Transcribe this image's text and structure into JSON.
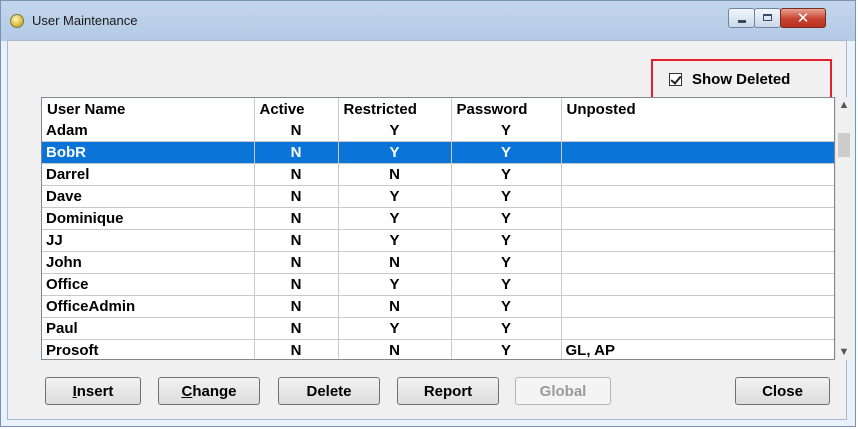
{
  "window": {
    "title": "User Maintenance",
    "icon": "app-icon",
    "controls": {
      "minimize_icon": "minimize-icon",
      "maximize_icon": "maximize-icon",
      "close_glyph": "✕"
    }
  },
  "show_deleted": {
    "label": "Show Deleted",
    "checked": true,
    "highlight_color": "#e0202c"
  },
  "table": {
    "columns": [
      "User Name",
      "Active",
      "Restricted",
      "Password",
      "Unposted"
    ],
    "rows": [
      [
        "Adam",
        "N",
        "Y",
        "Y",
        ""
      ],
      [
        "BobR",
        "N",
        "Y",
        "Y",
        ""
      ],
      [
        "Darrel",
        "N",
        "N",
        "Y",
        ""
      ],
      [
        "Dave",
        "N",
        "Y",
        "Y",
        ""
      ],
      [
        "Dominique",
        "N",
        "Y",
        "Y",
        ""
      ],
      [
        "JJ",
        "N",
        "Y",
        "Y",
        ""
      ],
      [
        "John",
        "N",
        "N",
        "Y",
        ""
      ],
      [
        "Office",
        "N",
        "Y",
        "Y",
        ""
      ],
      [
        "OfficeAdmin",
        "N",
        "N",
        "Y",
        ""
      ],
      [
        "Paul",
        "N",
        "Y",
        "Y",
        ""
      ],
      [
        "Prosoft",
        "N",
        "N",
        "Y",
        "GL, AP"
      ]
    ],
    "selected_row_index": 1,
    "selection_color": "#0a74d8"
  },
  "buttons": {
    "insert": {
      "access": "I",
      "rest": "nsert"
    },
    "change": {
      "access": "C",
      "rest": "hange"
    },
    "delete": "Delete",
    "report": "Report",
    "global": "Global",
    "close": "Close"
  }
}
